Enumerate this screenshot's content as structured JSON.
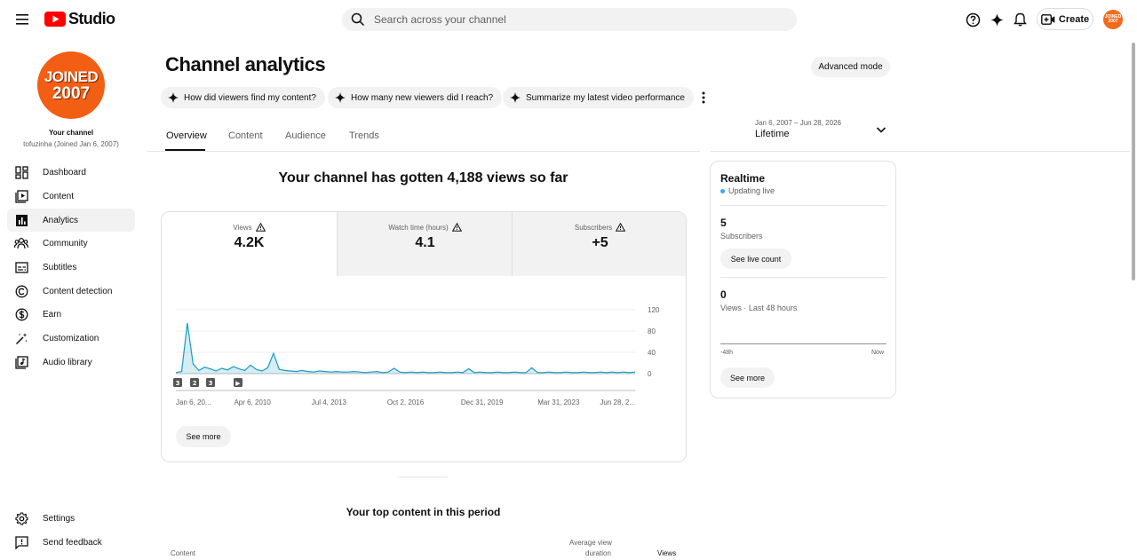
{
  "header": {
    "logo_text": "Studio",
    "search_placeholder": "Search across your channel",
    "create_label": "Create",
    "avatar_text": "JOINED 2007"
  },
  "sidebar": {
    "avatar_line1": "JOINED",
    "avatar_line2": "2007",
    "your_channel": "Your channel",
    "channel_name": "tofuzinha (Joined Jan 6, 2007)",
    "items": [
      {
        "label": "Dashboard",
        "icon": "dashboard-icon"
      },
      {
        "label": "Content",
        "icon": "content-icon"
      },
      {
        "label": "Analytics",
        "icon": "analytics-icon",
        "active": true
      },
      {
        "label": "Community",
        "icon": "community-icon"
      },
      {
        "label": "Subtitles",
        "icon": "subtitles-icon"
      },
      {
        "label": "Content detection",
        "icon": "copyright-icon"
      },
      {
        "label": "Earn",
        "icon": "dollar-icon"
      },
      {
        "label": "Customization",
        "icon": "magic-wand-icon"
      },
      {
        "label": "Audio library",
        "icon": "audio-library-icon"
      }
    ],
    "bottom_items": [
      {
        "label": "Settings",
        "icon": "gear-icon"
      },
      {
        "label": "Send feedback",
        "icon": "feedback-icon"
      }
    ]
  },
  "main": {
    "title": "Channel analytics",
    "advanced_mode": "Advanced mode",
    "chips": [
      "How did viewers find my content?",
      "How many new viewers did I reach?",
      "Summarize my latest video performance"
    ],
    "tabs": [
      "Overview",
      "Content",
      "Audience",
      "Trends"
    ],
    "active_tab": "Overview",
    "date_range": "Jan 6, 2007 – Jun 28, 2026",
    "date_label": "Lifetime",
    "headline": "Your channel has gotten 4,188 views so far",
    "metrics": [
      {
        "label": "Views",
        "value": "4.2K",
        "active": true
      },
      {
        "label": "Watch time (hours)",
        "value": "4.1"
      },
      {
        "label": "Subscribers",
        "value": "+5"
      }
    ],
    "see_more": "See more",
    "top_content_title": "Your top content in this period",
    "table_headers": {
      "content": "Content",
      "avg_line1": "Average view",
      "avg_line2": "duration",
      "views": "Views"
    }
  },
  "realtime": {
    "title": "Realtime",
    "status": "Updating live",
    "subscribers_value": "5",
    "subscribers_label": "Subscribers",
    "see_live_count": "See live count",
    "views_value": "0",
    "views_label": "Views · Last 48 hours",
    "axis_start": "-48h",
    "axis_end": "Now",
    "see_more": "See more"
  },
  "chart_data": {
    "type": "line",
    "series": [
      {
        "values": [
          2,
          4,
          95,
          18,
          6,
          12,
          9,
          5,
          10,
          7,
          13,
          9,
          6,
          16,
          8,
          5,
          11,
          38,
          8,
          6,
          5,
          4,
          6,
          4,
          3,
          5,
          4,
          3,
          4,
          3,
          3,
          4,
          3,
          2,
          3,
          4,
          2,
          3,
          10,
          3,
          2,
          3,
          2,
          3,
          2,
          2,
          3,
          2,
          2,
          3,
          2,
          9,
          2,
          3,
          2,
          2,
          3,
          2,
          2,
          3,
          2,
          2,
          11,
          2,
          2,
          3,
          2,
          2,
          3,
          2,
          2,
          3,
          2,
          2,
          3,
          2,
          3,
          2,
          3,
          2,
          3
        ]
      }
    ],
    "x_ticks": [
      "Jan 6, 20...",
      "Apr 6, 2010",
      "Jul 4, 2013",
      "Oct 2, 2016",
      "Dec 31, 2019",
      "Mar 31, 2023",
      "Jun 28, 2..."
    ],
    "y_ticks": [
      0,
      40,
      80,
      120
    ],
    "ylim": [
      0,
      120
    ],
    "grid": true,
    "markers": [
      "3",
      "2",
      "3",
      "▶"
    ],
    "color": "#1a9bc4"
  }
}
